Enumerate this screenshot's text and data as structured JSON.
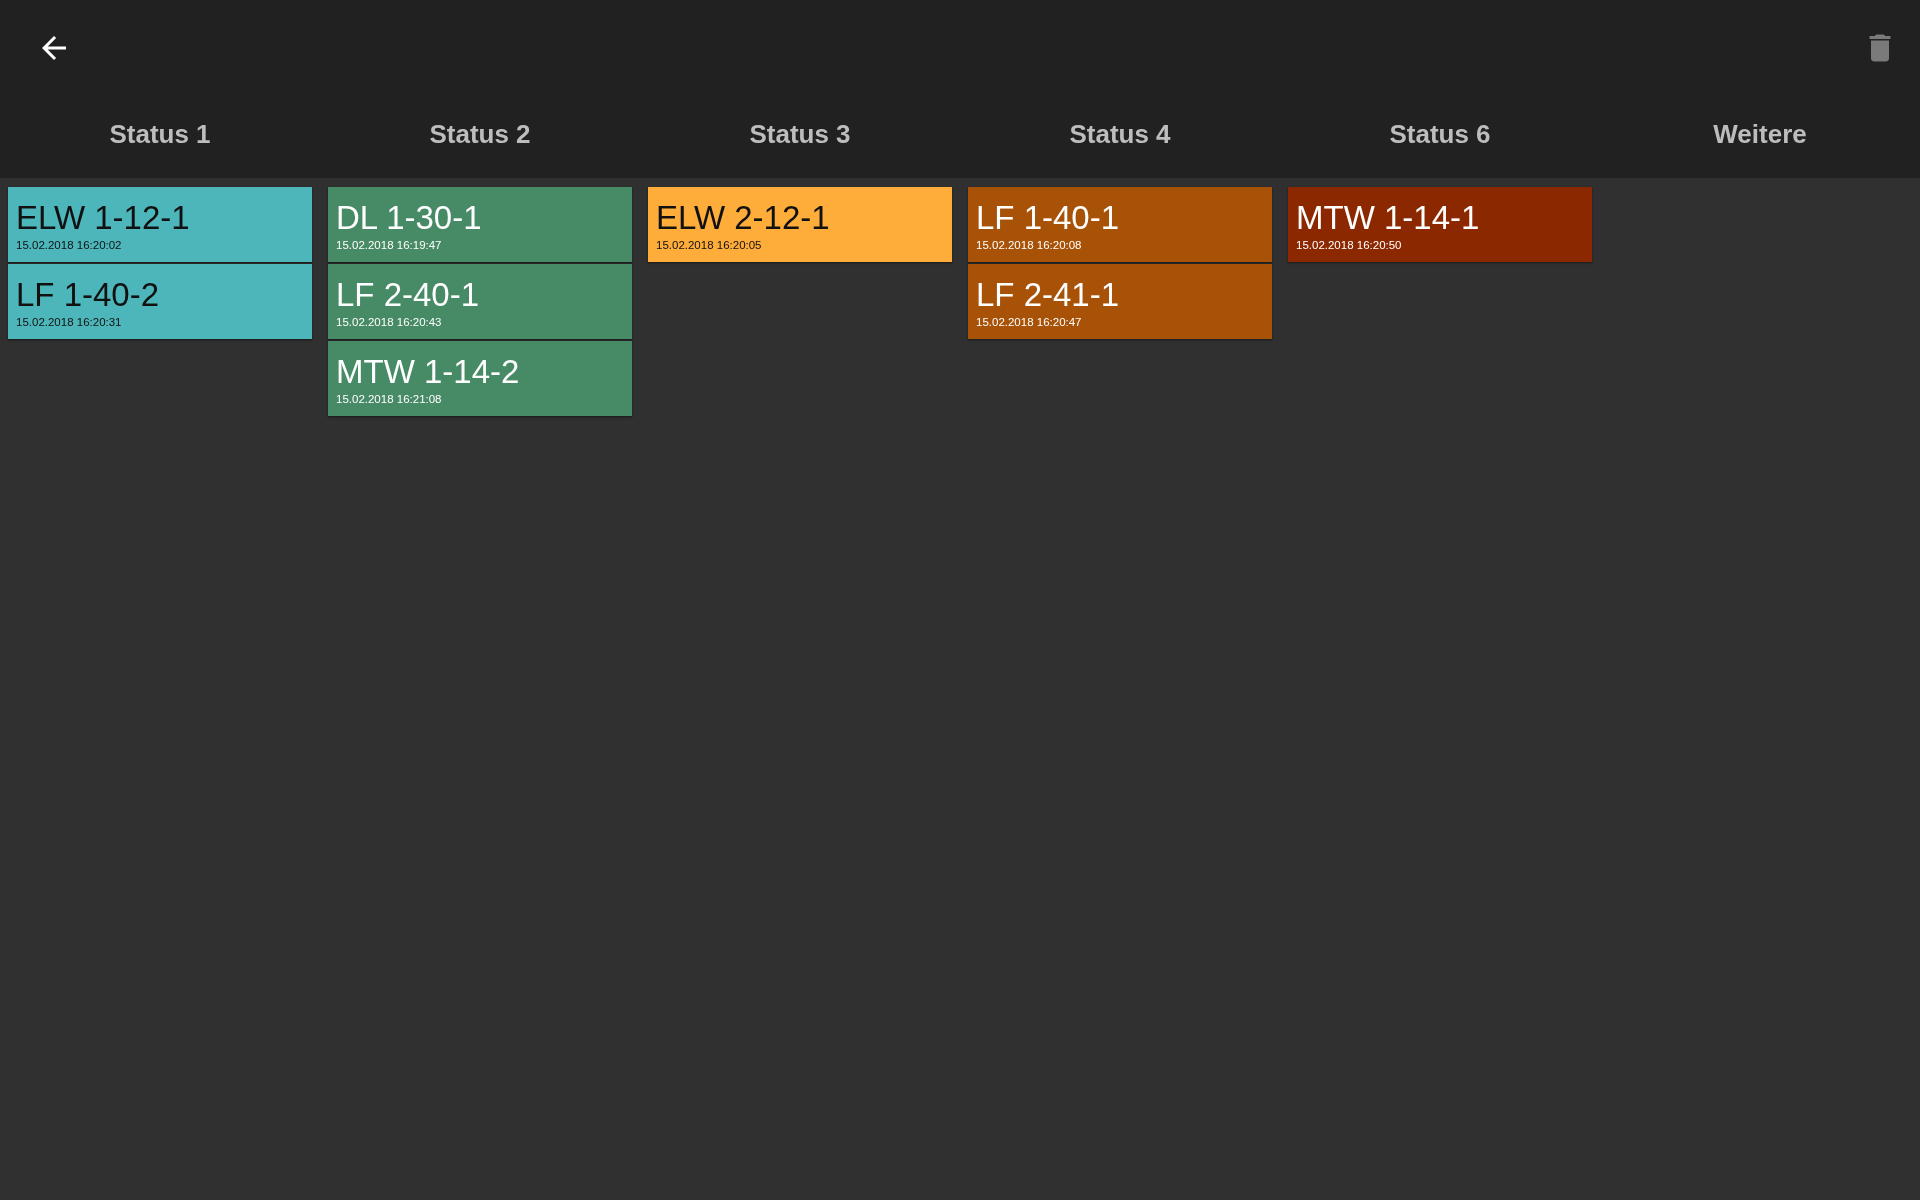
{
  "columns": [
    {
      "title": "Status 1",
      "color": "#4db6ba",
      "vehicles": [
        {
          "name": "ELW 1-12-1",
          "time": "15.02.2018 16:20:02"
        },
        {
          "name": "LF 1-40-2",
          "time": "15.02.2018 16:20:31"
        }
      ]
    },
    {
      "title": "Status 2",
      "color": "#478a66",
      "vehicles": [
        {
          "name": "DL 1-30-1",
          "time": "15.02.2018 16:19:47"
        },
        {
          "name": "LF 2-40-1",
          "time": "15.02.2018 16:20:43"
        },
        {
          "name": "MTW 1-14-2",
          "time": "15.02.2018 16:21:08"
        }
      ]
    },
    {
      "title": "Status 3",
      "color": "#ffad3a",
      "vehicles": [
        {
          "name": "ELW 2-12-1",
          "time": "15.02.2018 16:20:05"
        }
      ]
    },
    {
      "title": "Status 4",
      "color": "#a85208",
      "vehicles": [
        {
          "name": "LF 1-40-1",
          "time": "15.02.2018 16:20:08"
        },
        {
          "name": "LF 2-41-1",
          "time": "15.02.2018 16:20:47"
        }
      ]
    },
    {
      "title": "Status 6",
      "color": "#8c2800",
      "vehicles": [
        {
          "name": "MTW 1-14-1",
          "time": "15.02.2018 16:20:50"
        }
      ]
    },
    {
      "title": "Weitere"
    }
  ]
}
